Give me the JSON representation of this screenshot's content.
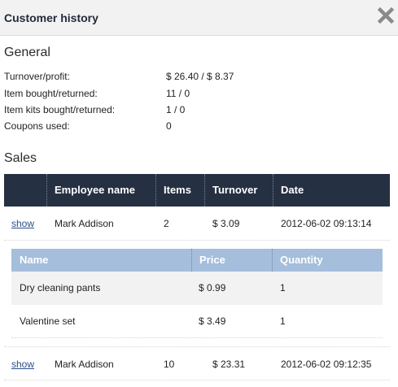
{
  "header": {
    "title": "Customer history",
    "close_icon": "close-icon"
  },
  "general": {
    "title": "General",
    "rows": [
      {
        "label": "Turnover/profit:",
        "value": "$ 26.40 / $ 8.37"
      },
      {
        "label": "Item bought/returned:",
        "value": "11 / 0"
      },
      {
        "label": "Item kits bought/returned:",
        "value": "1 / 0"
      },
      {
        "label": "Coupons used:",
        "value": "0"
      }
    ]
  },
  "sales": {
    "title": "Sales",
    "columns": [
      "Employee name",
      "Items",
      "Turnover",
      "Date"
    ],
    "rows": [
      {
        "show": "show",
        "employee": "Mark Addison",
        "items": "2",
        "turnover": "$ 3.09",
        "date": "2012-06-02 09:13:14"
      },
      {
        "show": "show",
        "employee": "Mark Addison",
        "items": "10",
        "turnover": "$ 23.31",
        "date": "2012-06-02 09:12:35"
      }
    ],
    "detail": {
      "columns": [
        "Name",
        "Price",
        "Quantity"
      ],
      "rows": [
        {
          "name": "Dry cleaning pants",
          "price": "$ 0.99",
          "quantity": "1"
        },
        {
          "name": "Valentine set",
          "price": "$ 3.49",
          "quantity": "1"
        }
      ]
    }
  },
  "colors": {
    "header_bg": "#f2f2f2",
    "table_head": "#253142",
    "detail_head": "#a4bedc",
    "detail_row_a": "#f2f2f2",
    "link": "#2a4f8c"
  }
}
